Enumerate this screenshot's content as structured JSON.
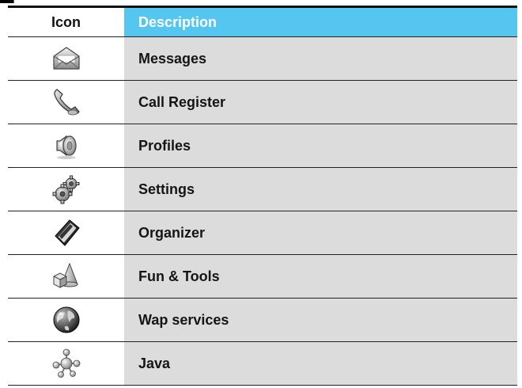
{
  "table": {
    "header": {
      "icon_label": "Icon",
      "description_label": "Description"
    },
    "rows": [
      {
        "icon": "envelope-icon",
        "label": "Messages"
      },
      {
        "icon": "phone-handset-icon",
        "label": "Call Register"
      },
      {
        "icon": "speaker-icon",
        "label": "Profiles"
      },
      {
        "icon": "gears-icon",
        "label": "Settings"
      },
      {
        "icon": "organizer-book-icon",
        "label": "Organizer"
      },
      {
        "icon": "shapes-icon",
        "label": "Fun & Tools"
      },
      {
        "icon": "globe-icon",
        "label": "Wap services"
      },
      {
        "icon": "molecule-icon",
        "label": "Java"
      }
    ]
  },
  "colors": {
    "header_accent": "#55c6f0",
    "row_background": "#dcdcdc",
    "rule": "#111111"
  }
}
